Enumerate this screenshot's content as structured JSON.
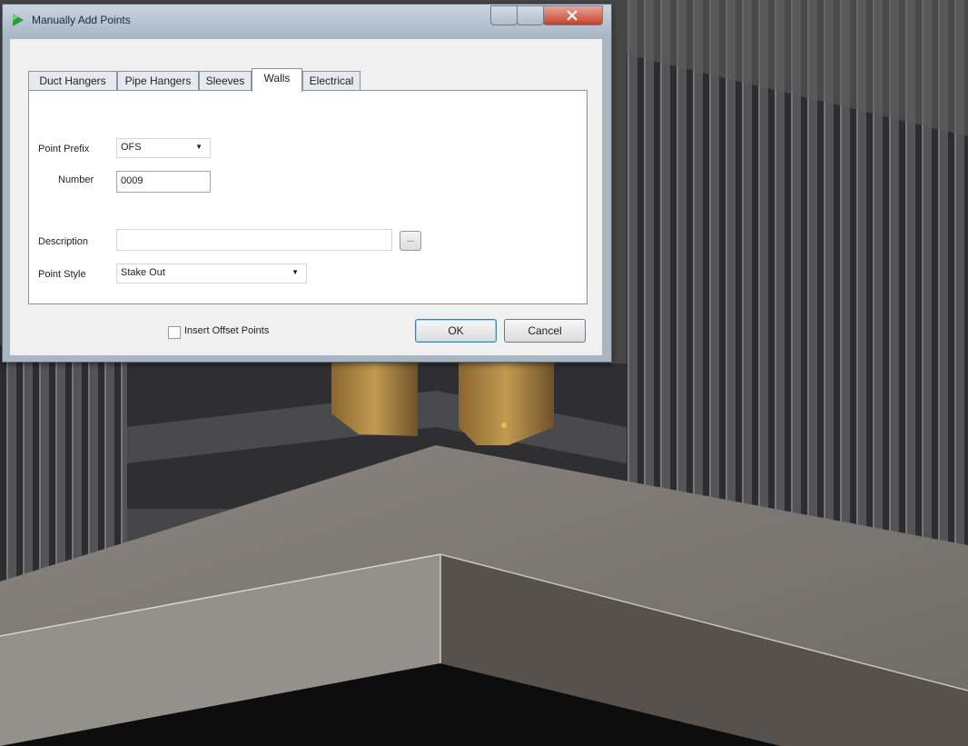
{
  "window": {
    "title": "Manually Add Points",
    "minimize_label": "–",
    "maximize_label": "□",
    "close_label": "×"
  },
  "tabs": [
    {
      "label": "Duct Hangers",
      "active": false
    },
    {
      "label": "Pipe Hangers",
      "active": false
    },
    {
      "label": "Sleeves",
      "active": false
    },
    {
      "label": "Walls",
      "active": true
    },
    {
      "label": "Electrical",
      "active": false
    }
  ],
  "form": {
    "point_prefix": {
      "label": "Point Prefix",
      "value": "OFS"
    },
    "number": {
      "label": "Number",
      "value": "0009"
    },
    "description": {
      "label": "Description",
      "value": ""
    },
    "browse_label": "...",
    "point_style": {
      "label": "Point Style",
      "value": "Stake Out"
    }
  },
  "footer": {
    "insert_offset_points_label": "Insert Offset Points",
    "insert_offset_points_checked": false,
    "ok_label": "OK",
    "cancel_label": "Cancel"
  },
  "colors": {
    "title_bar": "#b8c4d2",
    "close_button": "#c6402c",
    "tab_active": "#ffffff",
    "scene_floor": "#7d7873",
    "scene_wall": "#3c3c3e",
    "gold_box": "#b4893f"
  },
  "icons": {
    "app": "app-icon",
    "combo_arrow": "dropdown-arrow-icon",
    "close": "close-icon"
  }
}
